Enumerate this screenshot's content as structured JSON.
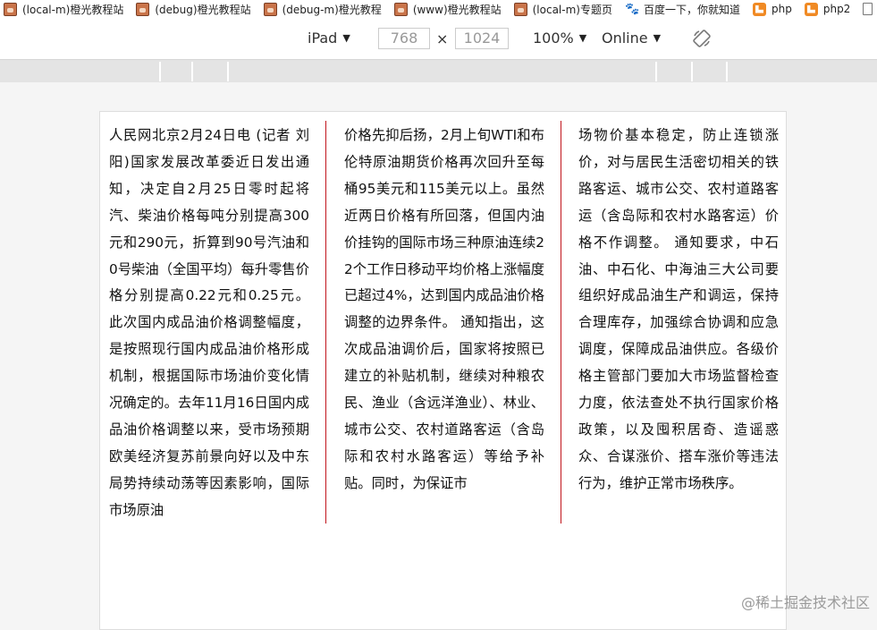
{
  "bookmarks": [
    {
      "label": "(local-m)橙光教程站",
      "icon": "anime-avatar-icon"
    },
    {
      "label": "(debug)橙光教程站",
      "icon": "anime-avatar-icon"
    },
    {
      "label": "(debug-m)橙光教程",
      "icon": "anime-avatar-icon"
    },
    {
      "label": "(www)橙光教程站",
      "icon": "anime-avatar-icon"
    },
    {
      "label": "(local-m)专题页",
      "icon": "anime-avatar-icon"
    },
    {
      "label": "百度一下，你就知道",
      "icon": "baidu-paw-icon"
    },
    {
      "label": "php",
      "icon": "php-icon"
    },
    {
      "label": "php2",
      "icon": "php-icon"
    },
    {
      "label": "",
      "icon": "document-icon"
    }
  ],
  "device_toolbar": {
    "device": "iPad",
    "width": "768",
    "times": "×",
    "height": "1024",
    "zoom": "100%",
    "network": "Online"
  },
  "article": {
    "columns": [
      "人民网北京2月24日电 (记者 刘阳)国家发展改革委近日发出通知，决定自2月25日零时起将汽、柴油价格每吨分别提高300元和290元，折算到90号汽油和0号柴油（全国平均）每升零售价格分别提高0.22元和0.25元。 此次国内成品油价格调整幅度，是按照现行国内成品油价格形成机制，根据国际市场油价变化情况确定的。去年11月16日国内成品油价格调整以来，受市场预期欧美经济复苏前景向好以及中东局势持续动荡等因素影响，国际市场原油",
      "价格先抑后扬，2月上旬WTI和布伦特原油期货价格再次回升至每桶95美元和115美元以上。虽然近两日价格有所回落，但国内油价挂钩的国际市场三种原油连续22个工作日移动平均价格上涨幅度已超过4%，达到国内成品油价格调整的边界条件。 通知指出，这次成品油调价后，国家将按照已建立的补贴机制，继续对种粮农民、渔业（含远洋渔业）、林业、城市公交、农村道路客运（含岛际和农村水路客运）等给予补贴。同时，为保证市",
      "场物价基本稳定，防止连锁涨价，对与居民生活密切相关的铁路客运、城市公交、农村道路客运（含岛际和农村水路客运）价格不作调整。 通知要求，中石油、中石化、中海油三大公司要组织好成品油生产和调运，保持合理库存，加强综合协调和应急调度，保障成品油供应。各级价格主管部门要加大市场监督检查力度，依法查处不执行国家价格政策，以及囤积居奇、造谣惑众、合谋涨价、搭车涨价等违法行为，维护正常市场秩序。"
    ],
    "divider_color": "#c0141c"
  },
  "watermark": "@稀土掘金技术社区"
}
